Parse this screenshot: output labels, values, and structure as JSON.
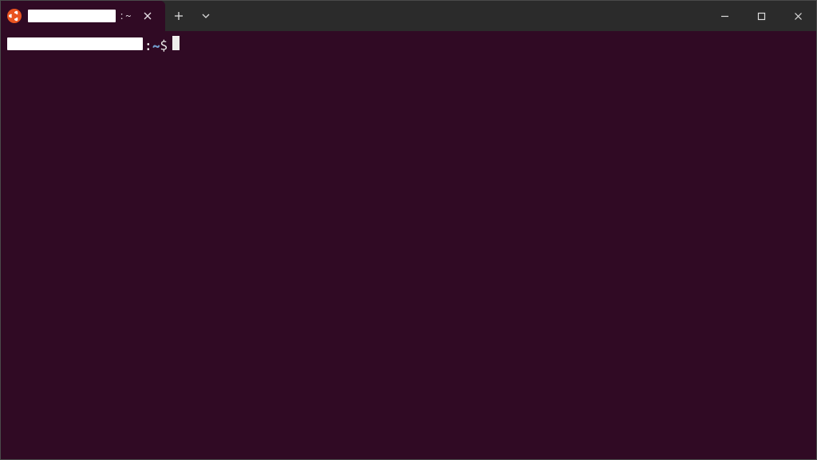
{
  "tab": {
    "title_redacted": true,
    "suffix": ": ~"
  },
  "prompt": {
    "user_host_redacted": true,
    "separator": ":",
    "cwd": "~",
    "symbol": "$"
  },
  "colors": {
    "terminal_bg": "#300a24",
    "titlebar_bg": "#2b2b2b",
    "text": "#eeeeec",
    "path_color": "#729fcf",
    "ubuntu_orange": "#e95420"
  },
  "icons": {
    "ubuntu": "ubuntu-logo",
    "close_tab": "close",
    "new_tab": "plus",
    "dropdown": "chevron-down",
    "minimize": "minimize",
    "maximize": "maximize",
    "close_window": "close"
  }
}
